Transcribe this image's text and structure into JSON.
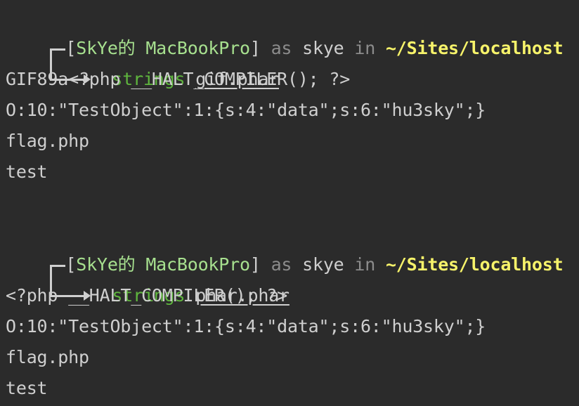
{
  "blocks": [
    {
      "prompt": {
        "open_bracket": "[",
        "host": "SkYe的 MacBookPro",
        "close_bracket": "]",
        "as": "as",
        "user": "skye",
        "in": "in",
        "path": "~/Sites/localhost"
      },
      "command": "strings",
      "argument": "gif.phar",
      "output": [
        "GIF89a<?php __HALT_COMPILER(); ?>",
        "O:10:\"TestObject\":1:{s:4:\"data\";s:6:\"hu3sky\";}",
        "flag.php",
        "test"
      ]
    },
    {
      "prompt": {
        "open_bracket": "[",
        "host": "SkYe的 MacBookPro",
        "close_bracket": "]",
        "as": "as",
        "user": "skye",
        "in": "in",
        "path": "~/Sites/localhost"
      },
      "command": "strings",
      "argument": "phar.phar",
      "output": [
        "<?php __HALT_COMPILER(); ?>",
        "O:10:\"TestObject\":1:{s:4:\"data\";s:6:\"hu3sky\";}",
        "flag.php",
        "test"
      ]
    }
  ],
  "colors": {
    "background": "#2b2b2b",
    "host": "#a7e08f",
    "path": "#f7f36a",
    "command": "#5fb53e",
    "keyword": "#8c8c8c",
    "text": "#cfcfcf"
  }
}
